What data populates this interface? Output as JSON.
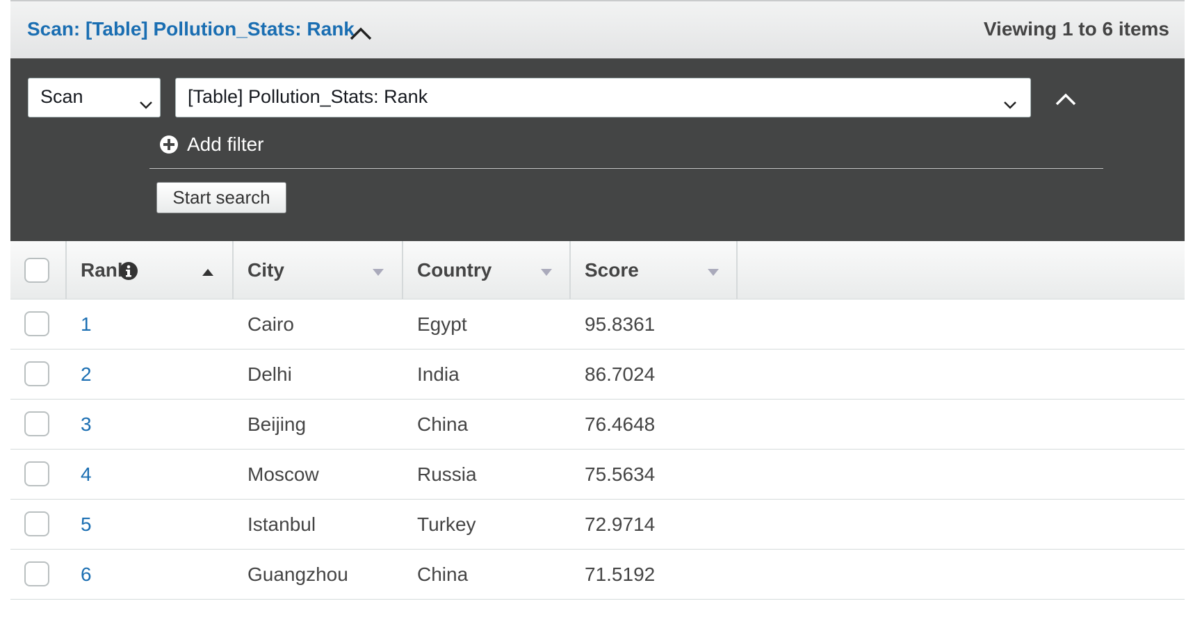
{
  "header": {
    "title": "Scan: [Table] Pollution_Stats: Rank",
    "item_count": "Viewing 1 to 6 items"
  },
  "search": {
    "operation": "Scan",
    "target": "[Table] Pollution_Stats: Rank",
    "add_filter_label": "Add filter",
    "start_search_label": "Start search"
  },
  "table": {
    "columns": [
      {
        "label": "Rank",
        "sort": "ascending"
      },
      {
        "label": "City",
        "sort": "none"
      },
      {
        "label": "Country",
        "sort": "none"
      },
      {
        "label": "Score",
        "sort": "none"
      }
    ],
    "rows": [
      {
        "rank": "1",
        "city": "Cairo",
        "country": "Egypt",
        "score": "95.8361"
      },
      {
        "rank": "2",
        "city": "Delhi",
        "country": "India",
        "score": "86.7024"
      },
      {
        "rank": "3",
        "city": "Beijing",
        "country": "China",
        "score": "76.4648"
      },
      {
        "rank": "4",
        "city": "Moscow",
        "country": "Russia",
        "score": "75.5634"
      },
      {
        "rank": "5",
        "city": "Istanbul",
        "country": "Turkey",
        "score": "72.9714"
      },
      {
        "rank": "6",
        "city": "Guangzhou",
        "country": "China",
        "score": "71.5192"
      }
    ]
  },
  "colors": {
    "link": "#1a6eb2",
    "dark_panel": "#444545",
    "header_text": "#444444"
  }
}
